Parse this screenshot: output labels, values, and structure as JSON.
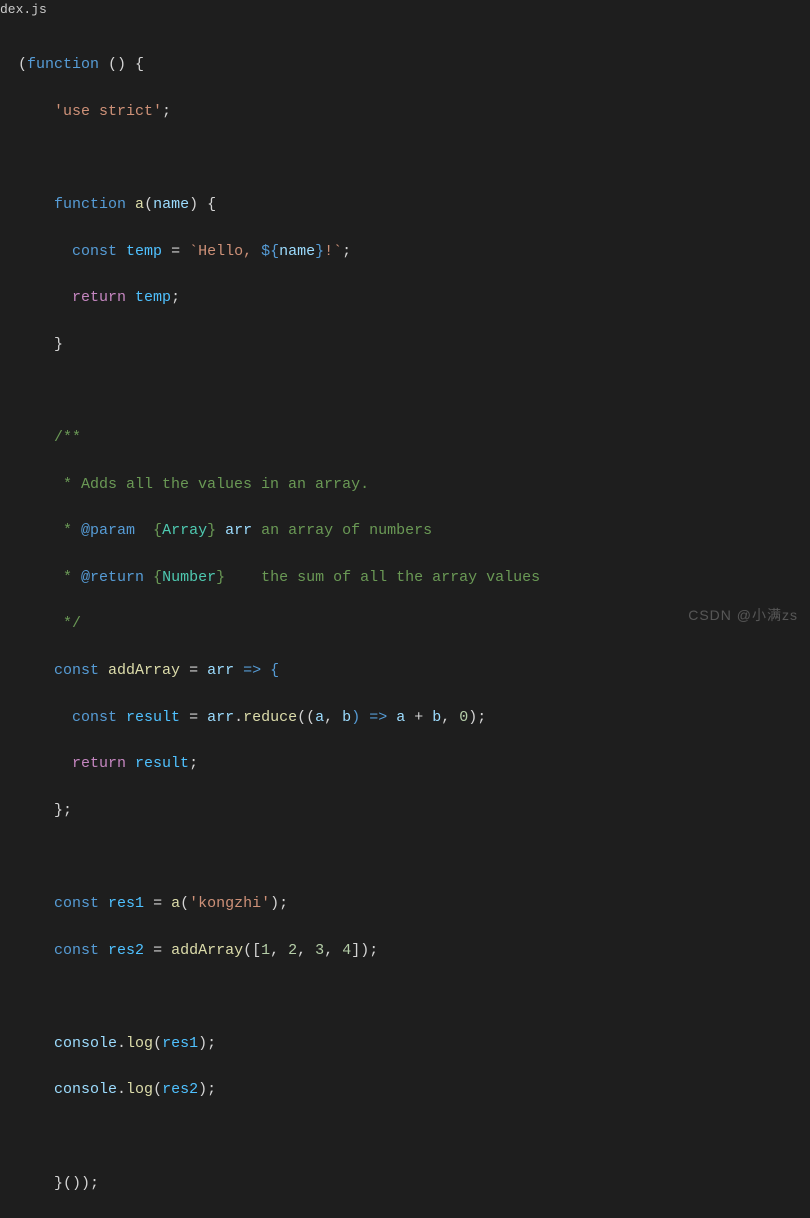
{
  "tab": {
    "title": "dex.js"
  },
  "code": {
    "l1_a": "(",
    "l1_kw": "function",
    "l1_b": " () {",
    "l2_str": "'use strict'",
    "l2_semi": ";",
    "l3": "",
    "l4_kw": "function",
    "l4_fn": "a",
    "l4_open": "(",
    "l4_param": "name",
    "l4_close": ") {",
    "l5_kw": "const",
    "l5_var": "temp",
    "l5_eq": " = ",
    "l5_s1": "`Hello, ",
    "l5_s2": "${",
    "l5_v2": "name",
    "l5_s3": "}",
    "l5_s4": "!`",
    "l5_semi": ";",
    "l6_kw": "return",
    "l6_var": "temp",
    "l6_semi": ";",
    "l7": "}",
    "l8": "",
    "l9": "/**",
    "l10": " * Adds all the values in an array.",
    "l11a": " * ",
    "l11tag": "@param",
    "l11b": "  {",
    "l11type": "Array",
    "l11c": "} ",
    "l11var": "arr",
    "l11d": " an array of numbers",
    "l12a": " * ",
    "l12tag": "@return",
    "l12b": " {",
    "l12type": "Number",
    "l12c": "}    the sum of all the array values",
    "l13": " */",
    "l14_kw": "const",
    "l14_fn": "addArray",
    "l14_eq": " = ",
    "l14_p": "arr",
    "l14_arrow": " => {",
    "l15_kw": "const",
    "l15_var": "result",
    "l15_eq": " = ",
    "l15_obj": "arr",
    "l15_dot": ".",
    "l15_fn": "reduce",
    "l15_a": "((",
    "l15_p1": "a",
    "l15_c": ", ",
    "l15_p2": "b",
    "l15_b": ") => ",
    "l15_v1": "a",
    "l15_plus": " + ",
    "l15_v2": "b",
    "l15_d": ", ",
    "l15_num": "0",
    "l15_e": ");",
    "l16_kw": "return",
    "l16_var": "result",
    "l16_semi": ";",
    "l17": "};",
    "l18": "",
    "l19_kw": "const",
    "l19_var": "res1",
    "l19_eq": " = ",
    "l19_fn": "a",
    "l19_a": "(",
    "l19_str": "'kongzhi'",
    "l19_b": ");",
    "l20_kw": "const",
    "l20_var": "res2",
    "l20_eq": " = ",
    "l20_fn": "addArray",
    "l20_a": "([",
    "l20_n1": "1",
    "l20_c1": ", ",
    "l20_n2": "2",
    "l20_c2": ", ",
    "l20_n3": "3",
    "l20_c3": ", ",
    "l20_n4": "4",
    "l20_b": "]);",
    "l21": "",
    "l22_obj": "console",
    "l22_dot": ".",
    "l22_fn": "log",
    "l22_a": "(",
    "l22_var": "res1",
    "l22_b": ");",
    "l23_obj": "console",
    "l23_dot": ".",
    "l23_fn": "log",
    "l23_a": "(",
    "l23_var": "res2",
    "l23_b": ");",
    "l24": "",
    "l25": "}());"
  },
  "watermark": "CSDN @小满zs"
}
